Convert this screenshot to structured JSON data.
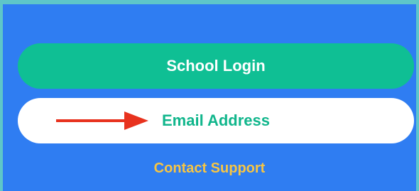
{
  "buttons": {
    "school_login": "School Login",
    "email_address": "Email Address"
  },
  "links": {
    "contact_support": "Contact Support"
  },
  "colors": {
    "outer_border": "#5ec6c9",
    "panel_background": "#2f7df2",
    "primary_button": "#0fbf94",
    "secondary_button": "#ffffff",
    "secondary_text": "#11b68c",
    "link_text": "#f6c544",
    "annotation_arrow": "#e8321e"
  },
  "icons": {
    "annotation": "red-arrow-icon"
  }
}
